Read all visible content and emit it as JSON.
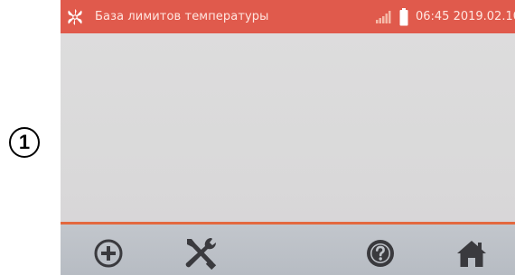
{
  "callout": {
    "label": "1"
  },
  "statusbar": {
    "title": "База лимитов температуры",
    "clock": "06:45 2019.02.10",
    "app_icon": "fan-icon",
    "signal_icon": "signal-icon",
    "battery_icon": "battery-icon"
  },
  "toolbar": {
    "buttons": [
      {
        "name": "add-button",
        "icon": "plus-circle-icon"
      },
      {
        "name": "settings-button",
        "icon": "tools-icon"
      },
      {
        "name": "help-button",
        "icon": "question-circle-icon"
      },
      {
        "name": "home-button",
        "icon": "home-icon"
      }
    ]
  },
  "colors": {
    "statusbar_bg": "#e05a4c",
    "statusbar_text": "#ffe6e0",
    "content_bg": "#dadada",
    "divider": "#e3683e",
    "toolbar_bg": "#bcc0c7",
    "icon_color": "#3a3a3e"
  }
}
